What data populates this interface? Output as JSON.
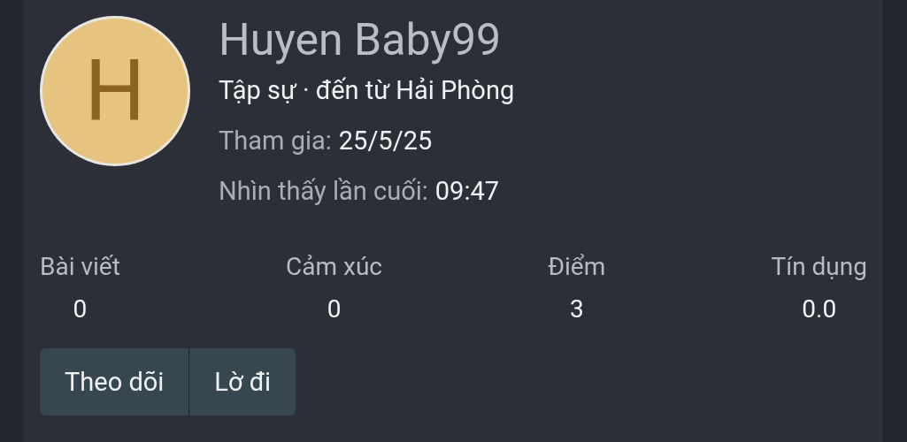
{
  "profile": {
    "avatar_letter": "H",
    "name": "Huyen Baby99",
    "subtitle": "Tập sự · đến từ Hải Phòng",
    "details": [
      {
        "label": "Tham gia:",
        "value": "25/5/25"
      },
      {
        "label": "Nhìn thấy lần cuối:",
        "value": "09:47"
      }
    ]
  },
  "stats": [
    {
      "label": "Bài viết",
      "value": "0"
    },
    {
      "label": "Cảm xúc",
      "value": "0"
    },
    {
      "label": "Điểm",
      "value": "3"
    },
    {
      "label": "Tín dụng",
      "value": "0.0"
    }
  ],
  "buttons": [
    "Theo dõi",
    "Lờ đi"
  ]
}
